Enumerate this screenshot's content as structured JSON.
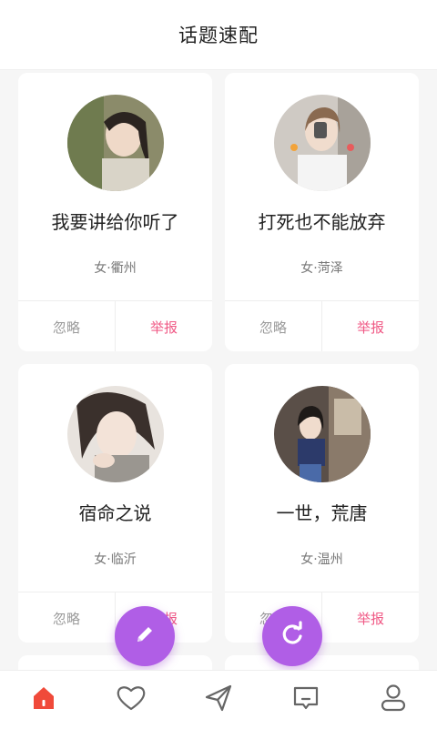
{
  "header": {
    "title": "话题速配"
  },
  "cards": [
    {
      "name": "我要讲给你听了",
      "meta": "女·衢州",
      "ignore_label": "忽略",
      "report_label": "举报"
    },
    {
      "name": "打死也不能放弃",
      "meta": "女·菏泽",
      "ignore_label": "忽略",
      "report_label": "举报"
    },
    {
      "name": "宿命之说",
      "meta": "女·临沂",
      "ignore_label": "忽略",
      "report_label": "举报"
    },
    {
      "name": "一世，荒唐",
      "meta": "女·温州",
      "ignore_label": "忽略",
      "report_label": "举报"
    }
  ],
  "fabs": {
    "edit_icon": "pencil-icon",
    "refresh_icon": "refresh-icon",
    "color": "#b05ee6"
  },
  "tabbar": {
    "items": [
      {
        "icon": "home-icon",
        "active": true
      },
      {
        "icon": "heart-icon",
        "active": false
      },
      {
        "icon": "send-icon",
        "active": false
      },
      {
        "icon": "message-icon",
        "active": false
      },
      {
        "icon": "profile-icon",
        "active": false
      }
    ],
    "active_color": "#f04a3a"
  }
}
